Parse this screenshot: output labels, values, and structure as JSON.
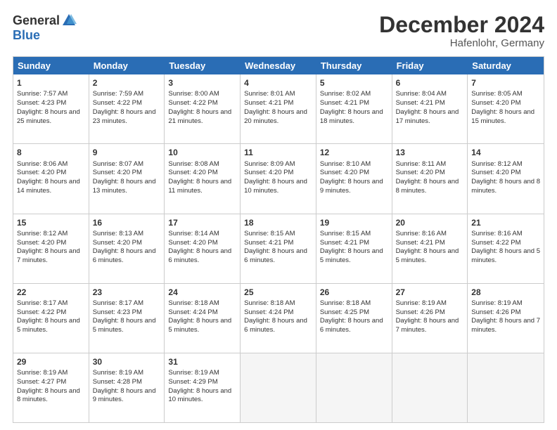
{
  "logo": {
    "general": "General",
    "blue": "Blue"
  },
  "title": "December 2024",
  "location": "Hafenlohr, Germany",
  "days": [
    "Sunday",
    "Monday",
    "Tuesday",
    "Wednesday",
    "Thursday",
    "Friday",
    "Saturday"
  ],
  "weeks": [
    [
      {
        "day": "1",
        "sunrise": "7:57 AM",
        "sunset": "4:23 PM",
        "daylight": "8 hours and 25 minutes."
      },
      {
        "day": "2",
        "sunrise": "7:59 AM",
        "sunset": "4:22 PM",
        "daylight": "8 hours and 23 minutes."
      },
      {
        "day": "3",
        "sunrise": "8:00 AM",
        "sunset": "4:22 PM",
        "daylight": "8 hours and 21 minutes."
      },
      {
        "day": "4",
        "sunrise": "8:01 AM",
        "sunset": "4:21 PM",
        "daylight": "8 hours and 20 minutes."
      },
      {
        "day": "5",
        "sunrise": "8:02 AM",
        "sunset": "4:21 PM",
        "daylight": "8 hours and 18 minutes."
      },
      {
        "day": "6",
        "sunrise": "8:04 AM",
        "sunset": "4:21 PM",
        "daylight": "8 hours and 17 minutes."
      },
      {
        "day": "7",
        "sunrise": "8:05 AM",
        "sunset": "4:20 PM",
        "daylight": "8 hours and 15 minutes."
      }
    ],
    [
      {
        "day": "8",
        "sunrise": "8:06 AM",
        "sunset": "4:20 PM",
        "daylight": "8 hours and 14 minutes."
      },
      {
        "day": "9",
        "sunrise": "8:07 AM",
        "sunset": "4:20 PM",
        "daylight": "8 hours and 13 minutes."
      },
      {
        "day": "10",
        "sunrise": "8:08 AM",
        "sunset": "4:20 PM",
        "daylight": "8 hours and 11 minutes."
      },
      {
        "day": "11",
        "sunrise": "8:09 AM",
        "sunset": "4:20 PM",
        "daylight": "8 hours and 10 minutes."
      },
      {
        "day": "12",
        "sunrise": "8:10 AM",
        "sunset": "4:20 PM",
        "daylight": "8 hours and 9 minutes."
      },
      {
        "day": "13",
        "sunrise": "8:11 AM",
        "sunset": "4:20 PM",
        "daylight": "8 hours and 8 minutes."
      },
      {
        "day": "14",
        "sunrise": "8:12 AM",
        "sunset": "4:20 PM",
        "daylight": "8 hours and 8 minutes."
      }
    ],
    [
      {
        "day": "15",
        "sunrise": "8:12 AM",
        "sunset": "4:20 PM",
        "daylight": "8 hours and 7 minutes."
      },
      {
        "day": "16",
        "sunrise": "8:13 AM",
        "sunset": "4:20 PM",
        "daylight": "8 hours and 6 minutes."
      },
      {
        "day": "17",
        "sunrise": "8:14 AM",
        "sunset": "4:20 PM",
        "daylight": "8 hours and 6 minutes."
      },
      {
        "day": "18",
        "sunrise": "8:15 AM",
        "sunset": "4:21 PM",
        "daylight": "8 hours and 6 minutes."
      },
      {
        "day": "19",
        "sunrise": "8:15 AM",
        "sunset": "4:21 PM",
        "daylight": "8 hours and 5 minutes."
      },
      {
        "day": "20",
        "sunrise": "8:16 AM",
        "sunset": "4:21 PM",
        "daylight": "8 hours and 5 minutes."
      },
      {
        "day": "21",
        "sunrise": "8:16 AM",
        "sunset": "4:22 PM",
        "daylight": "8 hours and 5 minutes."
      }
    ],
    [
      {
        "day": "22",
        "sunrise": "8:17 AM",
        "sunset": "4:22 PM",
        "daylight": "8 hours and 5 minutes."
      },
      {
        "day": "23",
        "sunrise": "8:17 AM",
        "sunset": "4:23 PM",
        "daylight": "8 hours and 5 minutes."
      },
      {
        "day": "24",
        "sunrise": "8:18 AM",
        "sunset": "4:24 PM",
        "daylight": "8 hours and 5 minutes."
      },
      {
        "day": "25",
        "sunrise": "8:18 AM",
        "sunset": "4:24 PM",
        "daylight": "8 hours and 6 minutes."
      },
      {
        "day": "26",
        "sunrise": "8:18 AM",
        "sunset": "4:25 PM",
        "daylight": "8 hours and 6 minutes."
      },
      {
        "day": "27",
        "sunrise": "8:19 AM",
        "sunset": "4:26 PM",
        "daylight": "8 hours and 7 minutes."
      },
      {
        "day": "28",
        "sunrise": "8:19 AM",
        "sunset": "4:26 PM",
        "daylight": "8 hours and 7 minutes."
      }
    ],
    [
      {
        "day": "29",
        "sunrise": "8:19 AM",
        "sunset": "4:27 PM",
        "daylight": "8 hours and 8 minutes."
      },
      {
        "day": "30",
        "sunrise": "8:19 AM",
        "sunset": "4:28 PM",
        "daylight": "8 hours and 9 minutes."
      },
      {
        "day": "31",
        "sunrise": "8:19 AM",
        "sunset": "4:29 PM",
        "daylight": "8 hours and 10 minutes."
      },
      null,
      null,
      null,
      null
    ]
  ],
  "labels": {
    "sunrise": "Sunrise:",
    "sunset": "Sunset:",
    "daylight": "Daylight:"
  }
}
